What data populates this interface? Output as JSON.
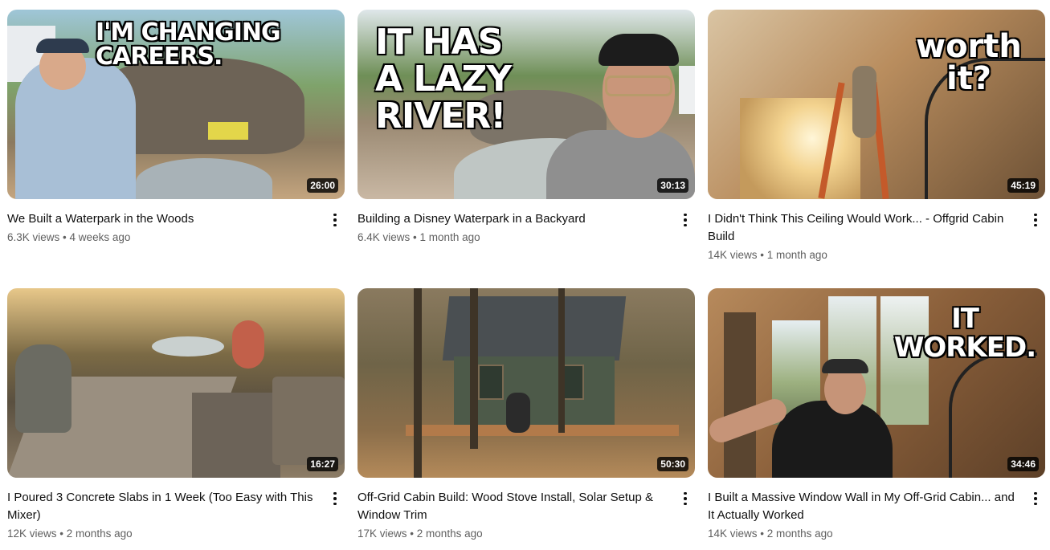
{
  "videos": [
    {
      "title": "We Built a Waterpark in the Woods",
      "views": "6.3K views",
      "age": "4 weeks ago",
      "duration": "26:00",
      "overlay": "I'M CHANGING CAREERS."
    },
    {
      "title": "Building a Disney Waterpark in a Backyard",
      "views": "6.4K views",
      "age": "1 month ago",
      "duration": "30:13",
      "overlay_lines": [
        "IT HAS",
        "A LAZY",
        "RIVER!"
      ]
    },
    {
      "title": "I Didn't Think This Ceiling Would Work... - Offgrid Cabin Build",
      "views": "14K views",
      "age": "1 month ago",
      "duration": "45:19",
      "overlay_lines": [
        "worth",
        "it?"
      ]
    },
    {
      "title": "I Poured 3 Concrete Slabs in 1 Week (Too Easy with This Mixer)",
      "views": "12K views",
      "age": "2 months ago",
      "duration": "16:27"
    },
    {
      "title": "Off-Grid Cabin Build: Wood Stove Install, Solar Setup & Window Trim",
      "views": "17K views",
      "age": "2 months ago",
      "duration": "50:30"
    },
    {
      "title": "I Built a Massive Window Wall in My Off-Grid Cabin... and It Actually Worked",
      "views": "14K views",
      "age": "2 months ago",
      "duration": "34:46",
      "overlay_lines": [
        "IT",
        "WORKED."
      ]
    }
  ],
  "separator": "•",
  "icons": {
    "menu": "more-vert-icon"
  }
}
